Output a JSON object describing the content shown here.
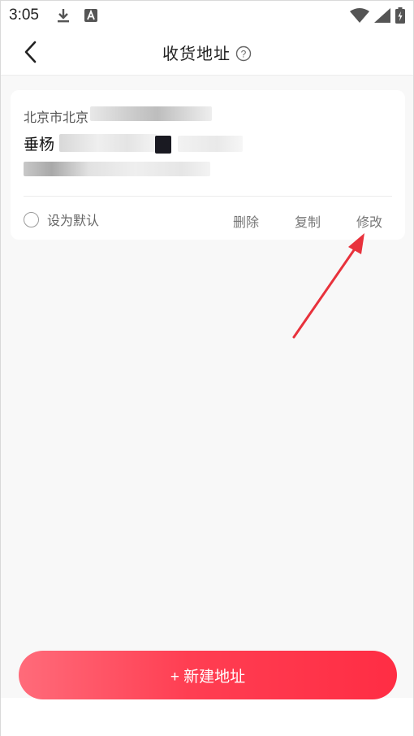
{
  "status_bar": {
    "time": "3:05",
    "icons": [
      "download-icon",
      "a-icon",
      "wifi-icon",
      "signal-icon",
      "battery-icon"
    ]
  },
  "header": {
    "title": "收货地址",
    "back_icon": "chevron-left-icon",
    "help_icon": "question-circle-icon"
  },
  "address": {
    "region": "北京市北京",
    "detail": "垂杨",
    "contact": "",
    "default_label": "设为默认",
    "actions": {
      "delete": "删除",
      "copy": "复制",
      "edit": "修改"
    }
  },
  "new_address_button": {
    "label": "+ 新建地址"
  },
  "colors": {
    "accent": "#ff2d44",
    "annotation_arrow": "#e8323c"
  }
}
